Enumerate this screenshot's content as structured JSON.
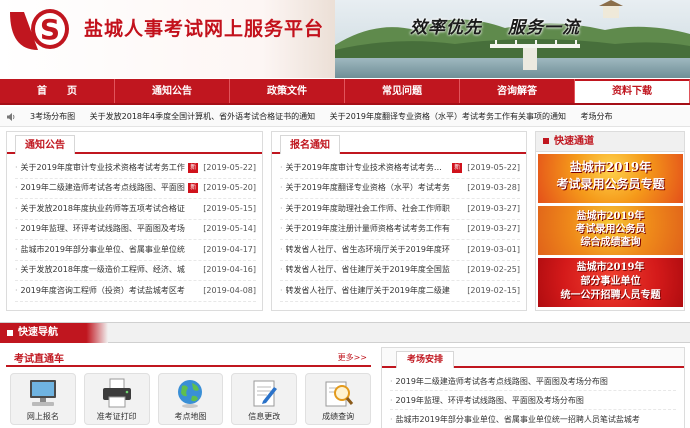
{
  "header": {
    "site_title": "盐城人事考试网上服务平台",
    "slogan_1": "效率优先",
    "slogan_2": "服务一流",
    "colors": {
      "brand_red": "#c0161f"
    }
  },
  "nav": {
    "items": [
      {
        "label": "首　　页"
      },
      {
        "label": "通知公告"
      },
      {
        "label": "政策文件"
      },
      {
        "label": "常见问题"
      },
      {
        "label": "咨询解答"
      },
      {
        "label": "资料下载"
      }
    ],
    "active_index": 5
  },
  "ticker": {
    "icon": "speaker-icon",
    "items": [
      "3考场分布图",
      "关于发放2018年4季度全国计算机、省外语考试合格证书的通知",
      "关于2019年度翻译专业资格（水平）考试考务工作有关事项的通知",
      "考场分布"
    ]
  },
  "notices": {
    "title": "通知公告",
    "items": [
      {
        "text": "关于2019年度审计专业技术资格考试考务工作",
        "new": true,
        "date": "[2019-05-22]"
      },
      {
        "text": "2019年二级建造师考试各考点线路图、平面图",
        "new": true,
        "date": "[2019-05-20]"
      },
      {
        "text": "关于发放2018年度执业药师等五项考试合格证",
        "new": false,
        "date": "[2019-05-15]"
      },
      {
        "text": "2019年监理、环评考试线路图、平面图及考场",
        "new": false,
        "date": "[2019-05-14]"
      },
      {
        "text": "盐城市2019年部分事业单位、省属事业单位统",
        "new": false,
        "date": "[2019-04-17]"
      },
      {
        "text": "关于发放2018年度一级造价工程师、经济、城",
        "new": false,
        "date": "[2019-04-16]"
      },
      {
        "text": "2019年度咨询工程师（投资）考试盐城考区考",
        "new": false,
        "date": "[2019-04-08]"
      }
    ]
  },
  "registration": {
    "title": "报名通知",
    "items": [
      {
        "text": "关于2019年度审计专业技术资格考试考务工作",
        "new": true,
        "date": "[2019-05-22]"
      },
      {
        "text": "关于2019年度翻译专业资格（水平）考试考务",
        "new": false,
        "date": "[2019-03-28]"
      },
      {
        "text": "关于2019年度助理社会工作师、社会工作师职",
        "new": false,
        "date": "[2019-03-27]"
      },
      {
        "text": "关于2019年度注册计量师资格考试考务工作有",
        "new": false,
        "date": "[2019-03-27]"
      },
      {
        "text": "转发省人社厅、省生态环境厅关于2019年度环",
        "new": false,
        "date": "[2019-03-01]"
      },
      {
        "text": "转发省人社厅、省住建厅关于2019年度全国监",
        "new": false,
        "date": "[2019-02-25]"
      },
      {
        "text": "转发省人社厅、省住建厅关于2019年度二级建",
        "new": false,
        "date": "[2019-02-15]"
      }
    ],
    "new_label": "新"
  },
  "quick_access": {
    "title": "快速通道",
    "banners": [
      {
        "line1": "盐城市2019年",
        "line2": "考试录用公务员专题",
        "line3": ""
      },
      {
        "line1": "盐城市2019年",
        "line2": "考试录用公务员",
        "line3": "综合成绩查询"
      },
      {
        "line1": "盐城市2019年",
        "line2": "部分事业单位",
        "line3": "统一公开招聘人员专题"
      }
    ]
  },
  "fast_nav": {
    "title": "快速导航"
  },
  "exam_direct": {
    "title": "考试直通车",
    "more": "更多>>",
    "icons": [
      {
        "label": "网上报名",
        "icon": "computer-icon"
      },
      {
        "label": "准考证打印",
        "icon": "printer-icon"
      },
      {
        "label": "考点地图",
        "icon": "globe-icon"
      },
      {
        "label": "信息更改",
        "icon": "edit-document-icon"
      },
      {
        "label": "成绩查询",
        "icon": "magnifier-icon"
      }
    ]
  },
  "exam_arrangement": {
    "title": "考场安排",
    "items": [
      "2019年二级建造师考试各考点线路图、平面图及考场分布图",
      "2019年监理、环评考试线路图、平面图及考场分布图",
      "盐城市2019年部分事业单位、省属事业单位统一招聘人员笔试盐城考"
    ]
  }
}
